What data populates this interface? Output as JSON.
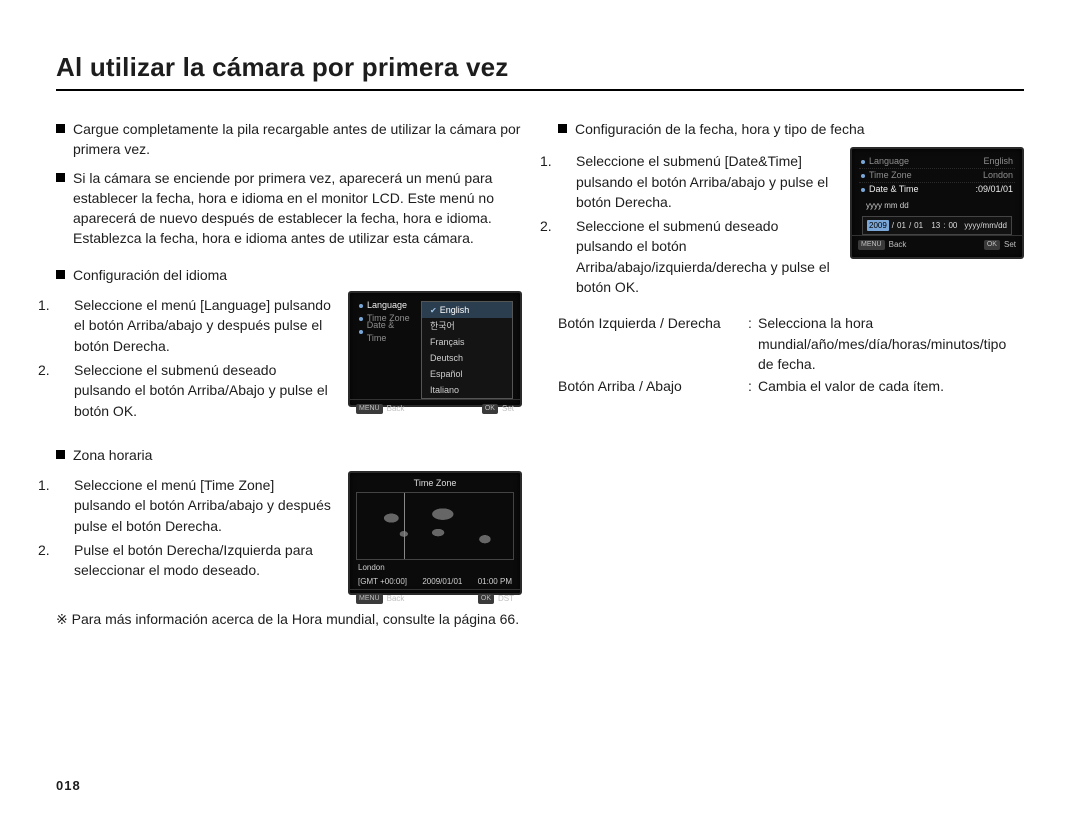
{
  "title": "Al utilizar la cámara por primera vez",
  "pageNumber": "018",
  "left": {
    "intro1": "Cargue completamente la pila recargable antes de utilizar la cámara por primera vez.",
    "intro2": "Si la cámara se enciende por primera vez, aparecerá un menú para establecer la fecha, hora e idioma en el monitor LCD. Este menú no aparecerá de nuevo después de establecer la fecha, hora e idioma. Establezca la fecha, hora e idioma antes de utilizar esta cámara.",
    "lang": {
      "heading": "Configuración del idioma",
      "steps": [
        "Seleccione el menú [Language] pulsando el botón Arriba/abajo y después pulse el botón Derecha.",
        "Seleccione el submenú deseado pulsando el botón Arriba/Abajo y pulse el botón OK."
      ],
      "lcd": {
        "rows": [
          {
            "label": "Language",
            "value": ""
          },
          {
            "label": "Time Zone",
            "value": ""
          },
          {
            "label": "Date & Time",
            "value": ""
          }
        ],
        "options": [
          "English",
          "한국어",
          "Français",
          "Deutsch",
          "Español",
          "Italiano"
        ],
        "footLeft": "MENU",
        "footLeftLabel": "Back",
        "footRight": "OK",
        "footRightLabel": "Set"
      }
    },
    "tz": {
      "heading": "Zona horaria",
      "steps": [
        "Seleccione el menú [Time Zone] pulsando el botón Arriba/abajo y después pulse el botón Derecha.",
        "Pulse el botón Derecha/Izquierda para seleccionar el modo deseado."
      ],
      "lcd": {
        "title": "Time Zone",
        "city": "London",
        "gmt": "[GMT +00:00]",
        "date": "2009/01/01",
        "time": "01:00 PM",
        "footLeft": "MENU",
        "footLeftLabel": "Back",
        "footRight": "OK",
        "footRightLabel": "DST"
      }
    },
    "note": "※ Para más información acerca de la Hora mundial, consulte la página 66."
  },
  "right": {
    "heading": "Configuración de la fecha, hora y tipo de fecha",
    "steps": [
      "Seleccione el submenú [Date&Time] pulsando el botón Arriba/abajo y pulse el botón Derecha.",
      "Seleccione el submenú deseado pulsando el botón Arriba/abajo/izquierda/derecha y pulse el botón OK."
    ],
    "lcd": {
      "rows": [
        {
          "label": "Language",
          "value": "English"
        },
        {
          "label": "Time Zone",
          "value": "London"
        },
        {
          "label": "Date & Time",
          "value": ":09/01/01"
        }
      ],
      "formatHint": "yyyy mm dd",
      "editRow": {
        "year": "2009",
        "sep": "/",
        "month": "01",
        "day": "01",
        "hh": "13",
        "mm": "00",
        "style": "yyyy/mm/dd"
      },
      "footLeft": "MENU",
      "footLeftLabel": "Back",
      "footRight": "OK",
      "footRightLabel": "Set"
    },
    "kv": [
      {
        "k": "Botón Izquierda / Derecha",
        "v": "Selecciona la hora mundial/año/mes/día/horas/minutos/tipo de fecha."
      },
      {
        "k": "Botón Arriba / Abajo",
        "v": "Cambia el valor de cada ítem."
      }
    ]
  }
}
